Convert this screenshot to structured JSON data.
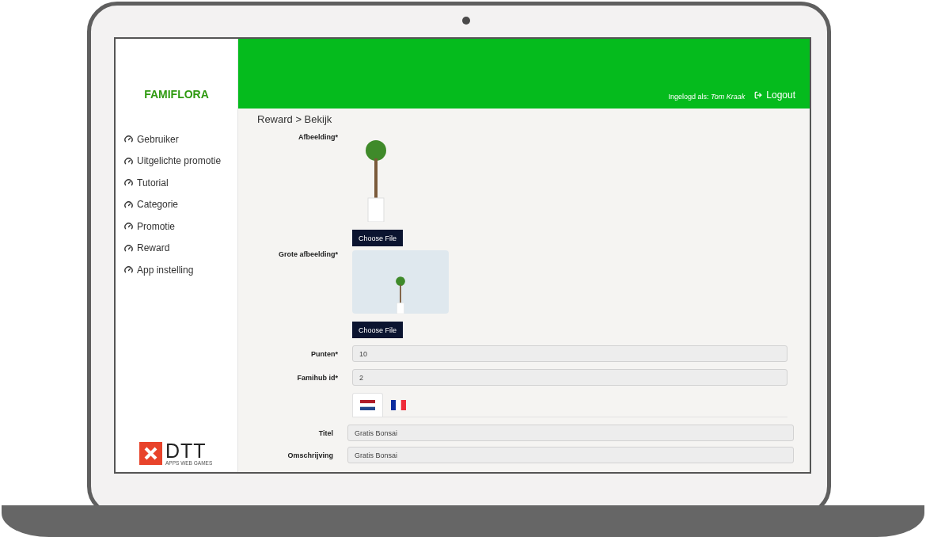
{
  "sidebar": {
    "brand": "FAMIFLORA",
    "items": [
      {
        "label": "Gebruiker"
      },
      {
        "label": "Uitgelichte promotie"
      },
      {
        "label": "Tutorial"
      },
      {
        "label": "Categorie"
      },
      {
        "label": "Promotie"
      },
      {
        "label": "Reward"
      },
      {
        "label": "App instelling"
      }
    ],
    "logo": {
      "name": "DTT",
      "tagline": "APPS WEB GAMES"
    }
  },
  "header": {
    "logged_in_label": "Ingelogd als:",
    "user": "Tom Kraak",
    "logout": "Logout"
  },
  "breadcrumb": "Reward > Bekijk",
  "images": [
    {
      "label": "Afbeelding*",
      "kind": "small",
      "button": "Choose File"
    },
    {
      "label": "Grote afbeelding*",
      "kind": "large",
      "button": "Choose File"
    }
  ],
  "fields": [
    {
      "label": "Punten*",
      "value": "10"
    },
    {
      "label": "Famihub id*",
      "value": "2"
    }
  ],
  "language_tabs": [
    {
      "kind": "nl",
      "selected": true
    },
    {
      "kind": "fr",
      "selected": false
    }
  ],
  "translated_fields": [
    {
      "label": "Titel",
      "value": "Gratis Bonsai"
    },
    {
      "label": "Omschrijving",
      "value": "Gratis Bonsai"
    }
  ]
}
